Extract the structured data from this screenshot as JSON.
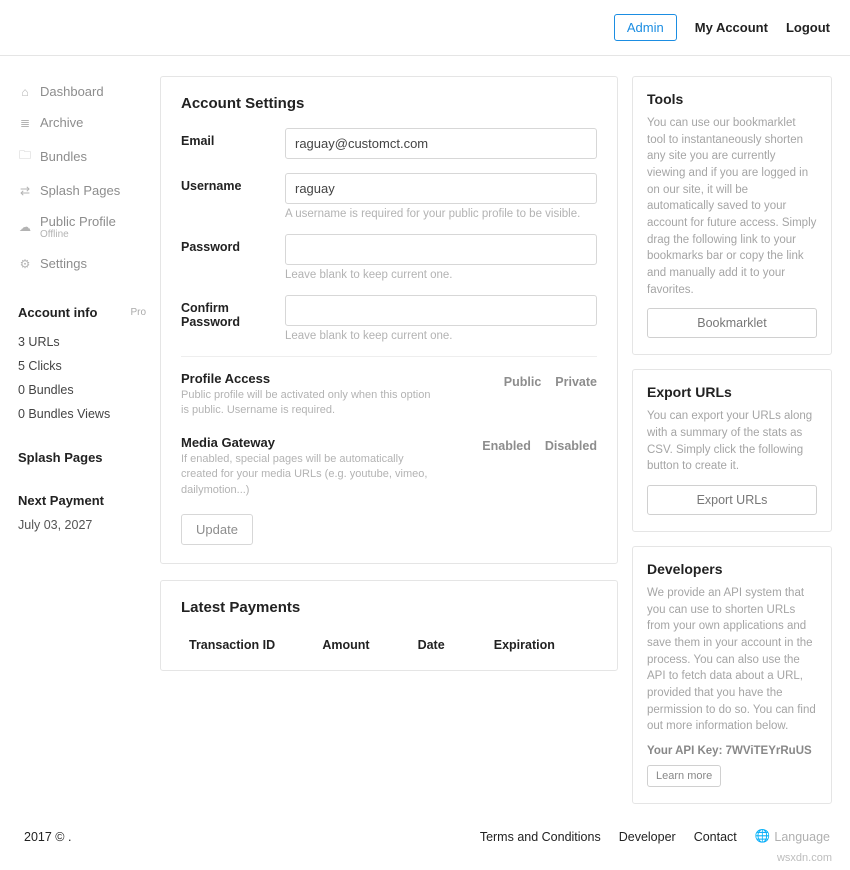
{
  "topnav": {
    "admin": "Admin",
    "account": "My Account",
    "logout": "Logout"
  },
  "sidebar": {
    "nav": [
      {
        "icon": "⌂",
        "label": "Dashboard"
      },
      {
        "icon": "≣",
        "label": "Archive"
      },
      {
        "icon": "🗀",
        "label": "Bundles"
      },
      {
        "icon": "⇄",
        "label": "Splash Pages"
      },
      {
        "icon": "☁",
        "label": "Public Profile",
        "sub": "Offline"
      },
      {
        "icon": "⚙",
        "label": "Settings"
      }
    ],
    "accountInfo": {
      "title": "Account info",
      "badge": "Pro"
    },
    "stats": [
      "3 URLs",
      "5 Clicks",
      "0 Bundles",
      "0 Bundles Views"
    ],
    "splash": "Splash Pages",
    "nextPayment": {
      "title": "Next Payment",
      "date": "July 03, 2027"
    }
  },
  "settings": {
    "title": "Account Settings",
    "email": {
      "label": "Email",
      "value": "raguay@customct.com"
    },
    "username": {
      "label": "Username",
      "value": "raguay",
      "hint": "A username is required for your public profile to be visible."
    },
    "password": {
      "label": "Password",
      "value": "",
      "hint": "Leave blank to keep current one."
    },
    "confirm": {
      "label": "Confirm Password",
      "value": "",
      "hint": "Leave blank to keep current one."
    },
    "profileAccess": {
      "title": "Profile Access",
      "desc": "Public profile will be activated only when this option is public. Username is required.",
      "opt1": "Public",
      "opt2": "Private"
    },
    "mediaGateway": {
      "title": "Media Gateway",
      "desc": "If enabled, special pages will be automatically created for your media URLs (e.g. youtube, vimeo, dailymotion...)",
      "opt1": "Enabled",
      "opt2": "Disabled"
    },
    "update": "Update"
  },
  "payments": {
    "title": "Latest Payments",
    "headers": [
      "Transaction ID",
      "Amount",
      "Date",
      "Expiration"
    ]
  },
  "tools": {
    "title": "Tools",
    "desc": "You can use our bookmarklet tool to instantaneously shorten any site you are currently viewing and if you are logged in on our site, it will be automatically saved to your account for future access. Simply drag the following link to your bookmarks bar or copy the link and manually add it to your favorites.",
    "button": "Bookmarklet"
  },
  "export": {
    "title": "Export URLs",
    "desc": "You can export your URLs along with a summary of the stats as CSV. Simply click the following button to create it.",
    "button": "Export URLs"
  },
  "dev": {
    "title": "Developers",
    "desc": "We provide an API system that you can use to shorten URLs from your own applications and save them in your account in the process. You can also use the API to fetch data about a URL, provided that you have the permission to do so. You can find out more information below.",
    "apikey_label": "Your API Key: ",
    "apikey": "7WViTEYrRuUS",
    "button": "Learn more"
  },
  "footer": {
    "copyright": "2017 © .",
    "links": [
      "Terms and Conditions",
      "Developer",
      "Contact"
    ],
    "lang": "Language"
  },
  "watermark": "wsxdn.com"
}
